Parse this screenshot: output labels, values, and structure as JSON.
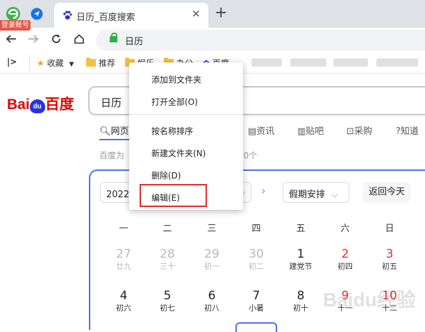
{
  "browser": {
    "account_badge": "登录账号",
    "tab": {
      "title": "日历_百度搜索",
      "close": "✕"
    },
    "new_tab": "+",
    "address": "日历"
  },
  "bookmarks": {
    "toggle": "|>",
    "items": [
      "收藏",
      "推荐",
      "娱乐",
      "办公",
      "百度"
    ]
  },
  "context_menu": {
    "items": [
      "添加到文件夹",
      "打开全部(O)",
      "按名称排序",
      "新建文件夹(N)",
      "删除(D)",
      "编辑(E)"
    ],
    "highlighted": "编辑(E)"
  },
  "page": {
    "logo_left": "Bai",
    "logo_paw": "du",
    "logo_right": "百度",
    "search_query": "日历",
    "nav_tabs": [
      "网页",
      "资讯",
      "贴吧",
      "采购",
      "知道"
    ],
    "result_stats_prefix": "百度为",
    "result_stats_suffix": "00个"
  },
  "calendar": {
    "year_select": "2022年",
    "holiday_select": "假期安排",
    "today_button": "返回今天",
    "weekdays": [
      "一",
      "二",
      "三",
      "四",
      "五",
      "六",
      "日"
    ],
    "rows": [
      [
        {
          "day": "27",
          "lunar": "廿九",
          "muted": true
        },
        {
          "day": "28",
          "lunar": "三十",
          "muted": true
        },
        {
          "day": "29",
          "lunar": "初一",
          "muted": true
        },
        {
          "day": "30",
          "lunar": "初二",
          "muted": true
        },
        {
          "day": "1",
          "lunar": "建党节"
        },
        {
          "day": "2",
          "lunar": "初四",
          "holiday": true
        },
        {
          "day": "3",
          "lunar": "初五",
          "holiday": true
        }
      ],
      [
        {
          "day": "4",
          "lunar": "初六"
        },
        {
          "day": "5",
          "lunar": "初七"
        },
        {
          "day": "6",
          "lunar": "初八"
        },
        {
          "day": "7",
          "lunar": "小暑"
        },
        {
          "day": "8",
          "lunar": "初十"
        },
        {
          "day": "9",
          "lunar": "十一",
          "holiday": true
        },
        {
          "day": "10",
          "lunar": "十二",
          "holiday": true
        }
      ]
    ]
  },
  "watermark": "Baidu经验",
  "colors": {
    "brand_blue": "#4e6ef2",
    "logo_red": "#e10601",
    "holiday_red": "#e12e2e",
    "highlight_red": "#e02a2a"
  }
}
